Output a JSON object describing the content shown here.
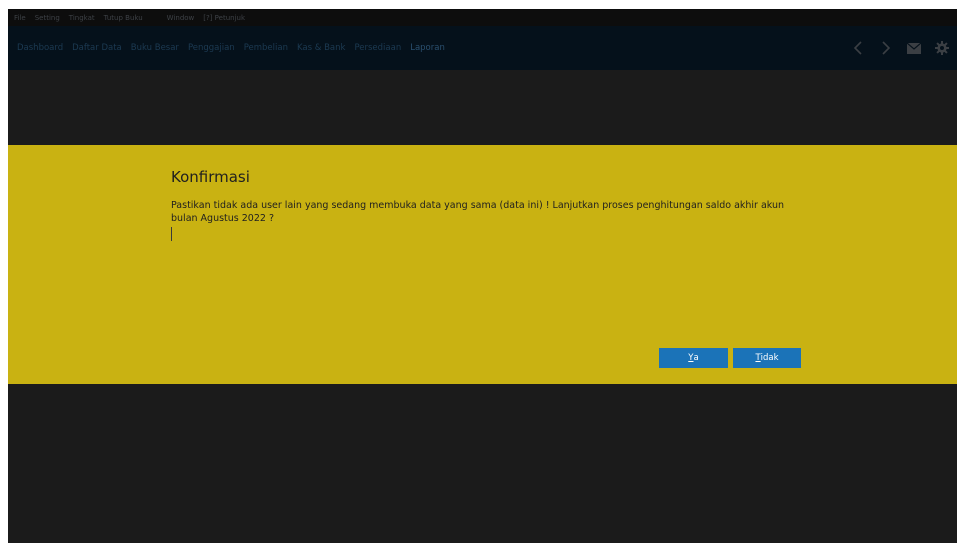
{
  "menubar": {
    "items": [
      "File",
      "Setting",
      "Tingkat",
      "Tutup Buku",
      "Window",
      "[?] Petunjuk"
    ]
  },
  "navbar": {
    "items": [
      "Dashboard",
      "Daftar Data",
      "Buku Besar",
      "Penggajian",
      "Pembelian",
      "Kas & Bank",
      "Persediaan",
      "Laporan"
    ]
  },
  "dialog": {
    "title": "Konfirmasi",
    "message": "Pastikan tidak ada user lain yang sedang membuka data yang sama (data ini) ! Lanjutkan proses penghitungan saldo akhir akun bulan Agustus 2022 ?",
    "yes_mnemonic": "Y",
    "yes_rest": "a",
    "no_mnemonic": "T",
    "no_rest": "idak"
  },
  "icons": [
    "chevron-left-icon",
    "chevron-right-icon",
    "mail-icon",
    "gear-icon"
  ],
  "colors": {
    "dialog_background": "#c9b212",
    "button_background": "#1b73b8",
    "overlay_background": "#1b1b1b"
  }
}
